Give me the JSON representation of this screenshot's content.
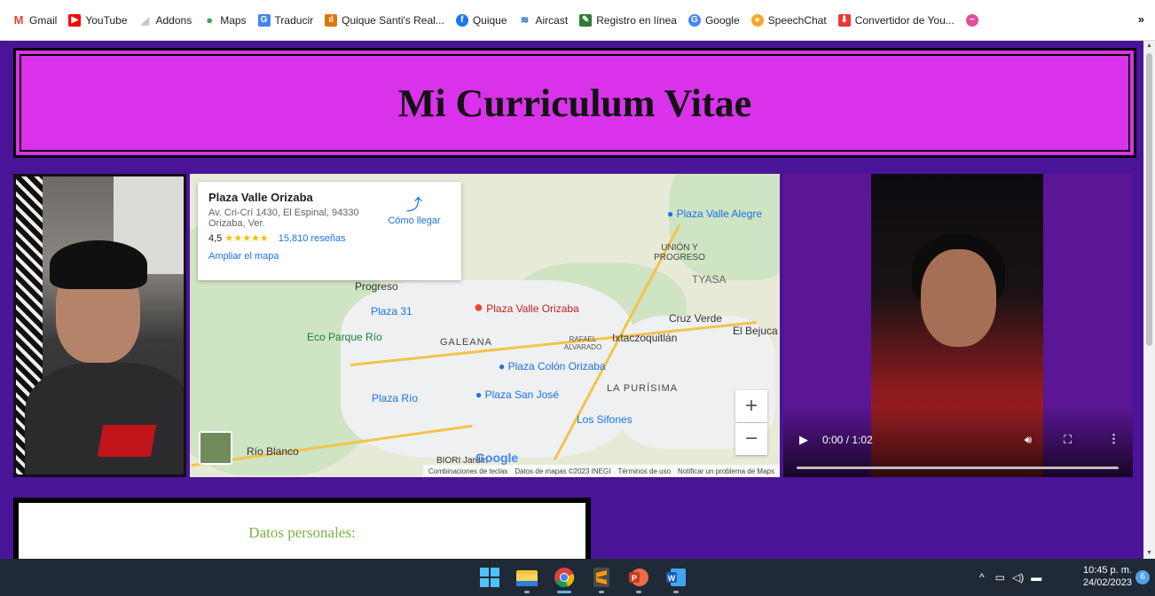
{
  "bookmarks": {
    "items": [
      {
        "label": "Gmail",
        "icon": "gmail-icon",
        "color": "#ea4335"
      },
      {
        "label": "YouTube",
        "icon": "youtube-icon",
        "color": "#ff0000"
      },
      {
        "label": "Addons",
        "icon": "addons-icon",
        "color": "#5f6368"
      },
      {
        "label": "Maps",
        "icon": "maps-icon",
        "color": "#34a853"
      },
      {
        "label": "Traducir",
        "icon": "translate-icon",
        "color": "#4285f4"
      },
      {
        "label": "Quique Santi's Real...",
        "icon": "analytics-icon",
        "color": "#e37400"
      },
      {
        "label": "Quique",
        "icon": "facebook-icon",
        "color": "#1877f2"
      },
      {
        "label": "Aircast",
        "icon": "aircast-icon",
        "color": "#1565c0"
      },
      {
        "label": "Registro en línea",
        "icon": "registro-icon",
        "color": "#2e7d32"
      },
      {
        "label": "Google",
        "icon": "google-icon",
        "color": "#4285f4"
      },
      {
        "label": "SpeechChat",
        "icon": "speechchat-icon",
        "color": "#f9a825"
      },
      {
        "label": "Convertidor de You...",
        "icon": "converter-icon",
        "color": "#e53935"
      }
    ],
    "more": "»"
  },
  "page": {
    "title": "Mi Curriculum Vitae",
    "datos_heading": "Datos personales:"
  },
  "map": {
    "place_name": "Plaza Valle Orizaba",
    "address": "Av. Cri-Crí 1430, El Espinal, 94330 Orizaba, Ver.",
    "rating": "4,5",
    "stars": "★★★★★",
    "reviews": "15,810 reseñas",
    "enlarge": "Ampliar el mapa",
    "directions": "Cómo llegar",
    "zoom_in": "+",
    "zoom_out": "−",
    "labels": [
      {
        "text": "Plaza Valle Alegre",
        "color": "#1a73e8"
      },
      {
        "text": "UNIÓN Y PROGRESO",
        "color": "#444444"
      },
      {
        "text": "TYASA",
        "color": "#666666"
      },
      {
        "text": "Progreso",
        "color": "#333333"
      },
      {
        "text": "Plaza 31",
        "color": "#1a73e8"
      },
      {
        "text": "Plaza Valle Orizaba",
        "color": "#c5221f"
      },
      {
        "text": "Cruz Verde",
        "color": "#333333"
      },
      {
        "text": "El Bejuca",
        "color": "#333333"
      },
      {
        "text": "Eco Parque Río",
        "color": "#188038"
      },
      {
        "text": "GALEANA",
        "color": "#444444"
      },
      {
        "text": "RAFAEL ALVARADO",
        "color": "#555555"
      },
      {
        "text": "Ixtaczoquitlán",
        "color": "#333333"
      },
      {
        "text": "Plaza Colón Orizaba",
        "color": "#1a73e8"
      },
      {
        "text": "LA PURÍSIMA",
        "color": "#444444"
      },
      {
        "text": "Plaza Río",
        "color": "#1a73e8"
      },
      {
        "text": "Plaza San José",
        "color": "#1a73e8"
      },
      {
        "text": "Los Sifones",
        "color": "#1a73e8"
      },
      {
        "text": "Río Blanco",
        "color": "#333333"
      },
      {
        "text": "BIORI Jardín",
        "color": "#333333"
      }
    ],
    "footer": [
      "Combinaciones de teclas",
      "Datos de mapas ©2023 INEGI",
      "Términos de uso",
      "Notificar un problema de Maps"
    ],
    "google": "Google"
  },
  "video": {
    "time": "0:00 / 1:02",
    "progress": 0
  },
  "taskbar": {
    "time": "10:45 p. m.",
    "date": "24/02/2023",
    "notifications": "6",
    "apps": [
      "start-icon",
      "file-explorer-icon",
      "chrome-icon",
      "sublime-icon",
      "powerpoint-icon",
      "word-icon"
    ]
  }
}
